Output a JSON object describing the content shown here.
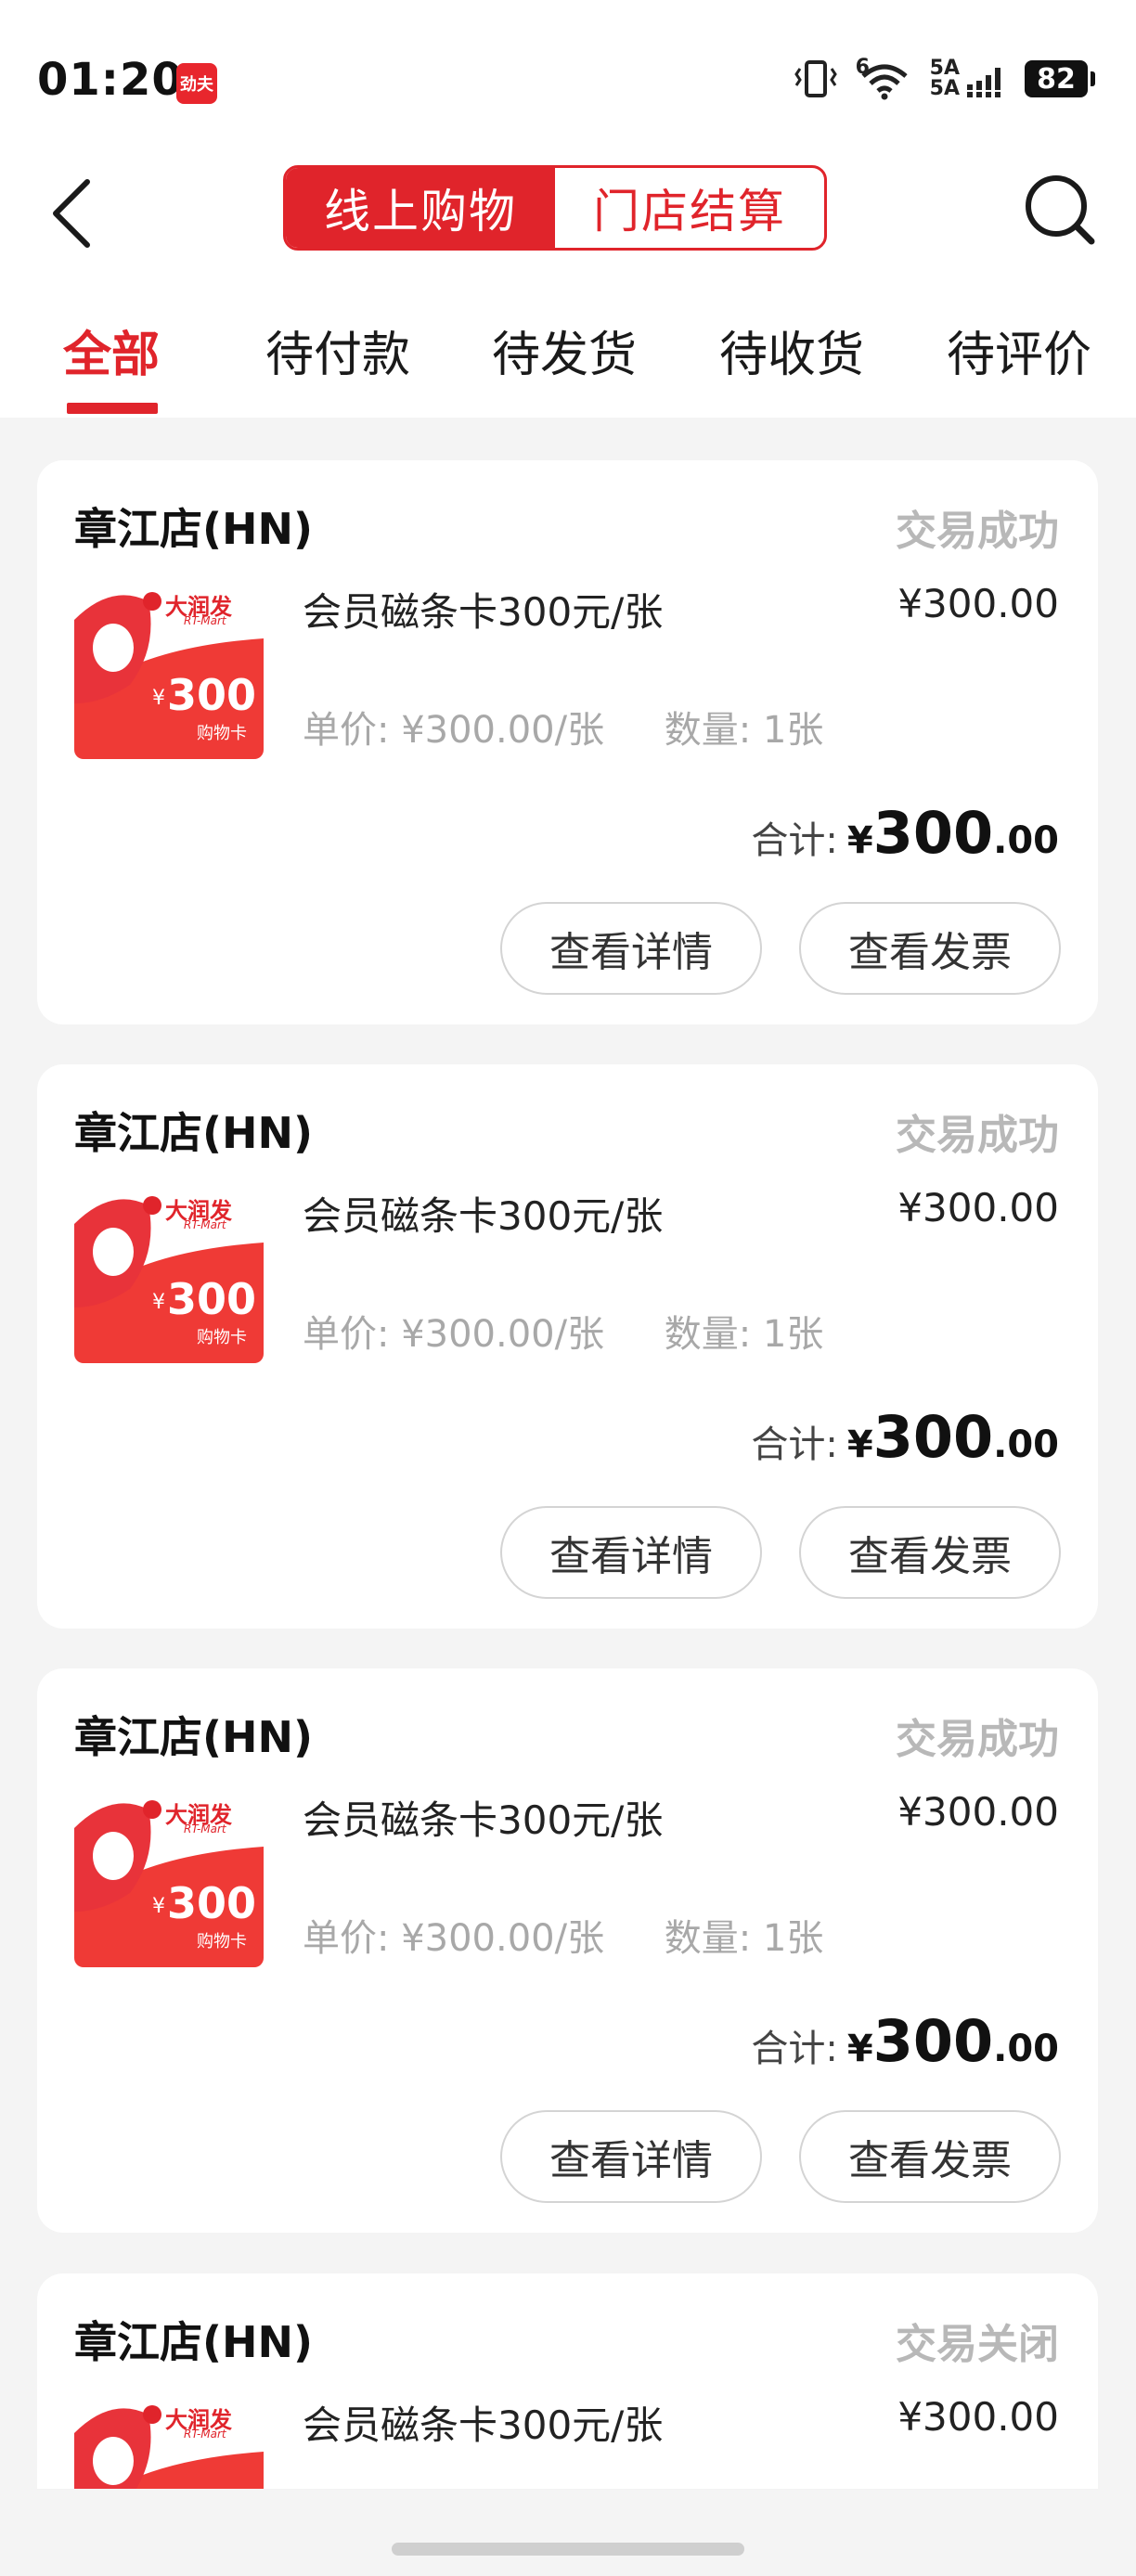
{
  "status_bar": {
    "time": "01:20",
    "app_badge": "劲夫",
    "network_top": "5A",
    "network_bottom": "5A",
    "wifi_label": "6",
    "battery": "82"
  },
  "header": {
    "seg_online": "线上购物",
    "seg_store": "门店结算"
  },
  "tabs": [
    {
      "label": "全部"
    },
    {
      "label": "待付款"
    },
    {
      "label": "待发货"
    },
    {
      "label": "待收货"
    },
    {
      "label": "待评价"
    }
  ],
  "thumb": {
    "brand": "大润发",
    "brand_sub": "RT-Mart",
    "yen": "¥",
    "amount": "300",
    "caption": "购物卡"
  },
  "orders": [
    {
      "store": "章江店(HN)",
      "status": "交易成功",
      "product": "会员磁条卡300元/张",
      "price": "¥300.00",
      "unit_price": "单价: ¥300.00/张",
      "quantity": "数量: 1张",
      "total_label": "合计:",
      "total_yen": "¥",
      "total_int": "300",
      "total_dec": ".00",
      "btn_detail": "查看详情",
      "btn_invoice": "查看发票"
    },
    {
      "store": "章江店(HN)",
      "status": "交易成功",
      "product": "会员磁条卡300元/张",
      "price": "¥300.00",
      "unit_price": "单价: ¥300.00/张",
      "quantity": "数量: 1张",
      "total_label": "合计:",
      "total_yen": "¥",
      "total_int": "300",
      "total_dec": ".00",
      "btn_detail": "查看详情",
      "btn_invoice": "查看发票"
    },
    {
      "store": "章江店(HN)",
      "status": "交易成功",
      "product": "会员磁条卡300元/张",
      "price": "¥300.00",
      "unit_price": "单价: ¥300.00/张",
      "quantity": "数量: 1张",
      "total_label": "合计:",
      "total_yen": "¥",
      "total_int": "300",
      "total_dec": ".00",
      "btn_detail": "查看详情",
      "btn_invoice": "查看发票"
    },
    {
      "store": "章江店(HN)",
      "status": "交易关闭",
      "product": "会员磁条卡300元/张",
      "price": "¥300.00"
    }
  ],
  "colors": {
    "accent": "#e0242b",
    "muted": "#b8b8b8",
    "background": "#f4f4f4"
  },
  "icons": {
    "back": "chevron-left-icon",
    "search": "search-icon"
  }
}
